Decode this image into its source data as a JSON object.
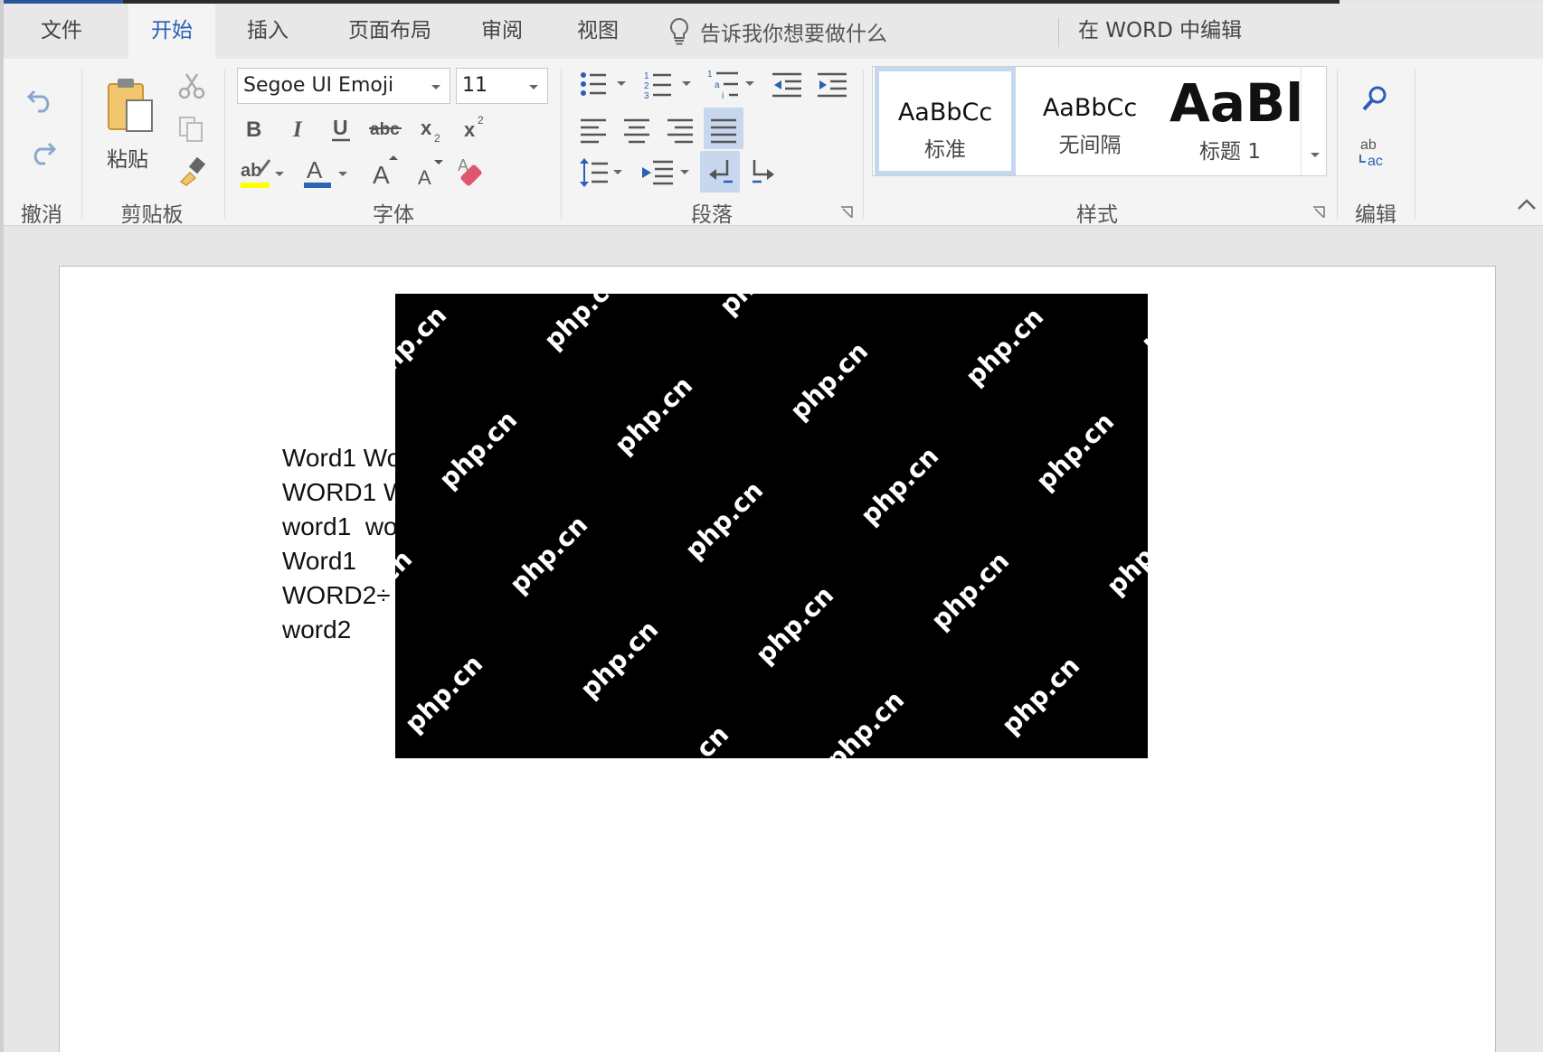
{
  "tabs": [
    {
      "label": "文件",
      "active": false
    },
    {
      "label": "开始",
      "active": true
    },
    {
      "label": "插入",
      "active": false
    },
    {
      "label": "页面布局",
      "active": false
    },
    {
      "label": "审阅",
      "active": false
    },
    {
      "label": "视图",
      "active": false
    }
  ],
  "tell_me": "告诉我你想要做什么",
  "edit_in_word": "在 WORD 中编辑",
  "ribbon": {
    "groups": {
      "undo": "撤消",
      "clipboard": "剪贴板",
      "font": "字体",
      "paragraph": "段落",
      "styles": "样式",
      "editing": "编辑"
    },
    "paste_label": "粘贴",
    "font_name": "Segoe UI Emoji",
    "font_size": "11",
    "styles": [
      {
        "sample": "AaBbCc",
        "name": "标准",
        "selected": true
      },
      {
        "sample": "AaBbCc",
        "name": "无间隔",
        "selected": false
      },
      {
        "sample": "AaBl",
        "name": "标题 1",
        "selected": false
      }
    ],
    "colors": {
      "accent": "#2a5fb5",
      "highlight": "#ffff00",
      "font_color": "#2f63b5",
      "eraser": "#e0566f"
    }
  },
  "document": {
    "lines": [
      "Word1 Wo",
      "WORD1 W",
      "word1  wo",
      "Word1",
      "WORD2÷",
      "word2"
    ],
    "watermark_text": "php.cn",
    "image_color": "#000000"
  }
}
